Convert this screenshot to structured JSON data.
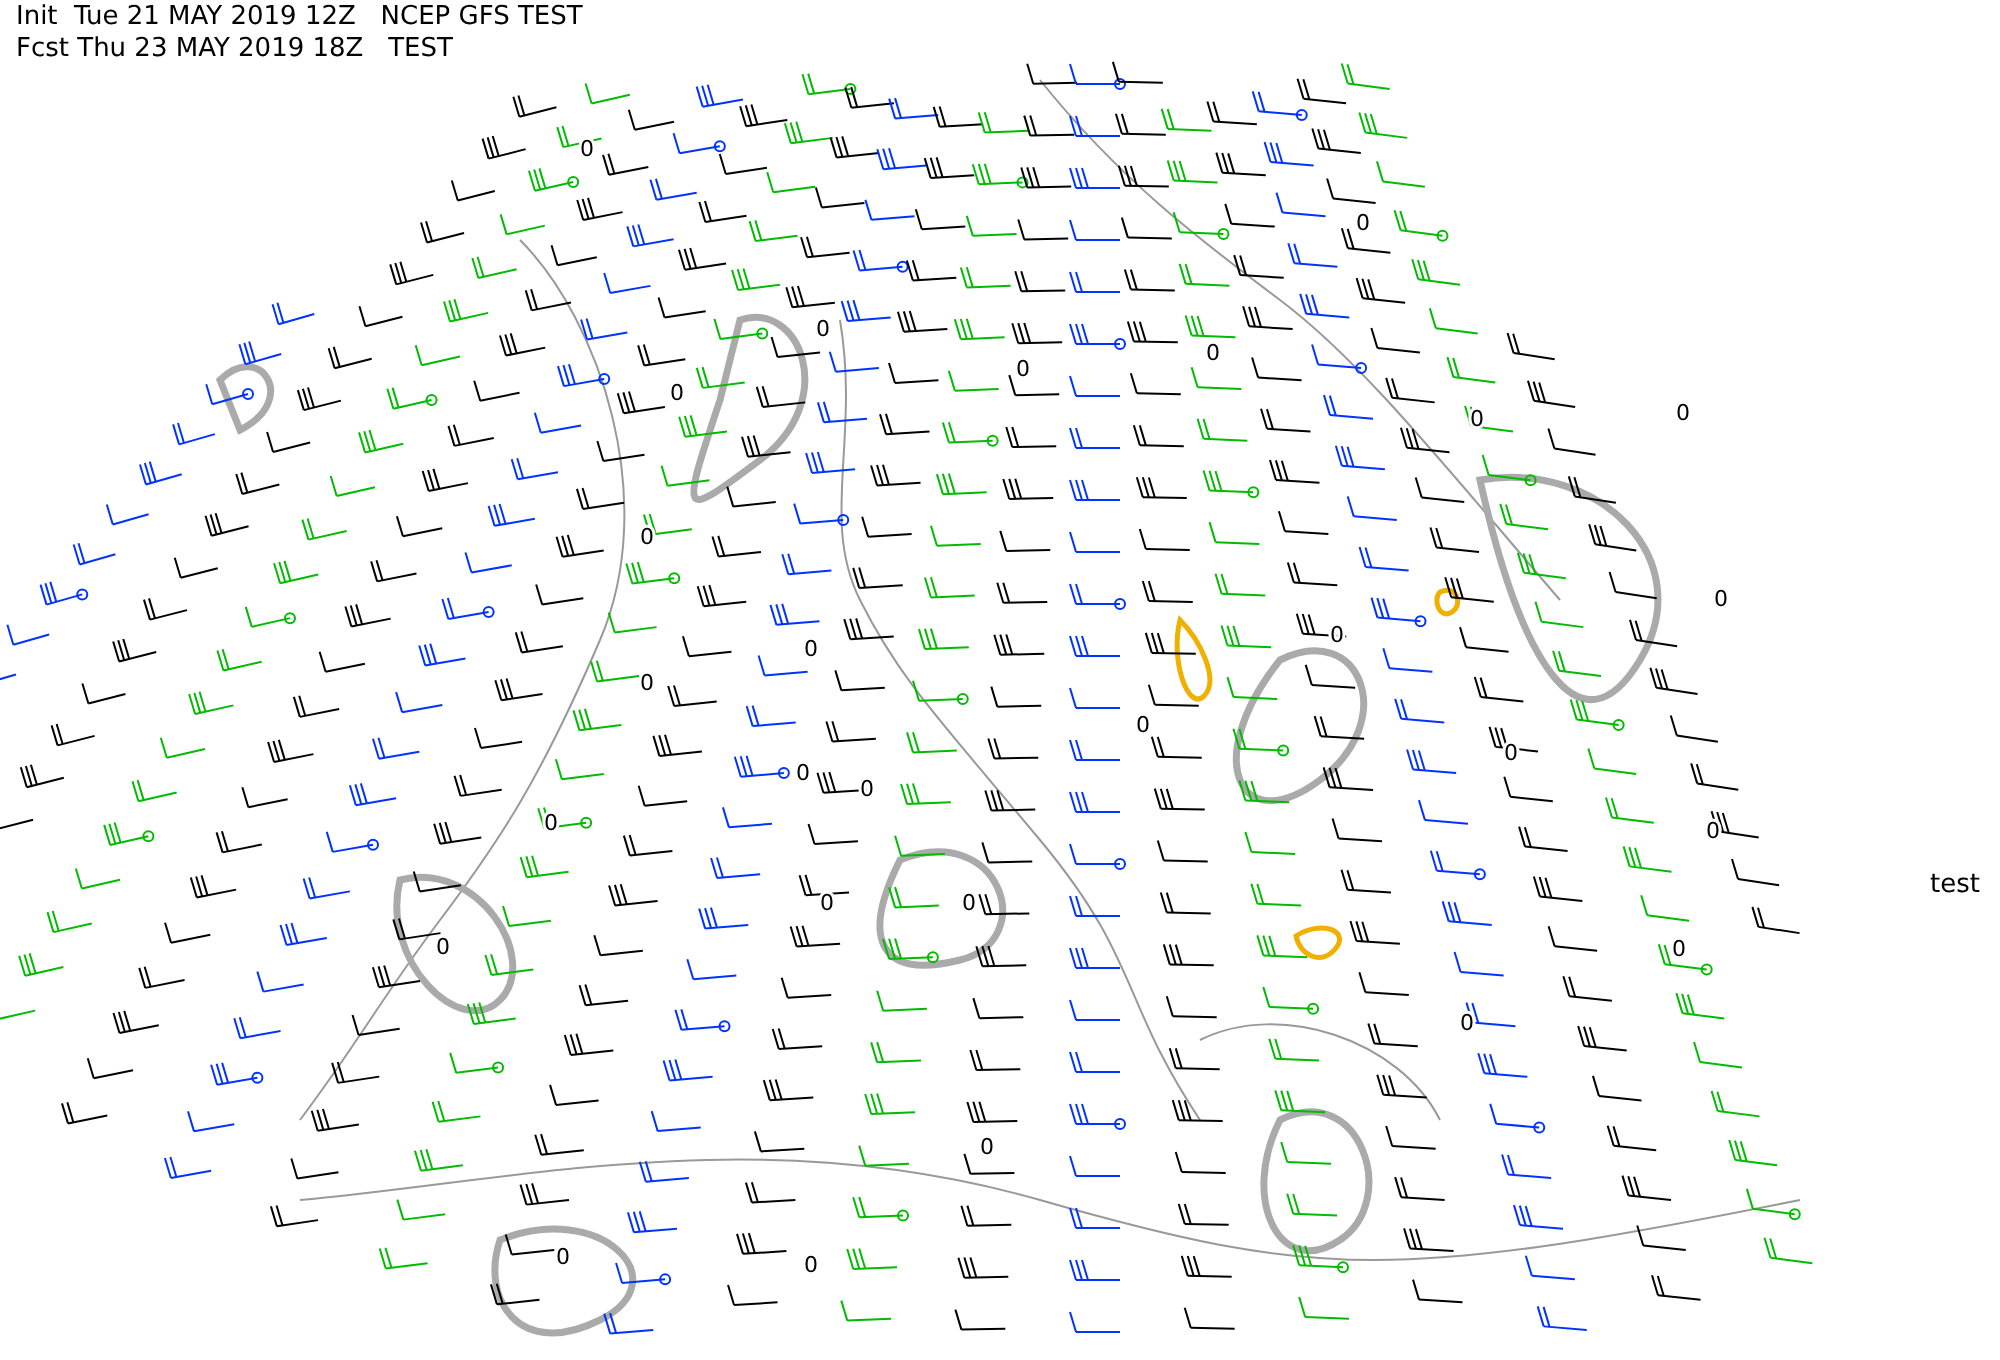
{
  "header": {
    "lines": [
      "Init  Tue 21 MAY 2019 12Z   NCEP GFS TEST",
      "Fcst Thu 23 MAY 2019 18Z   TEST"
    ]
  },
  "map": {
    "contour_labels": [
      "0",
      "0",
      "0",
      "0",
      "0",
      "0",
      "0",
      "0",
      "0",
      "0",
      "0",
      "0",
      "0",
      "0",
      "0",
      "0",
      "0",
      "0",
      "0",
      "0",
      "0",
      "0",
      "0",
      "0",
      "0",
      "0",
      "0"
    ],
    "side_label": "test"
  }
}
